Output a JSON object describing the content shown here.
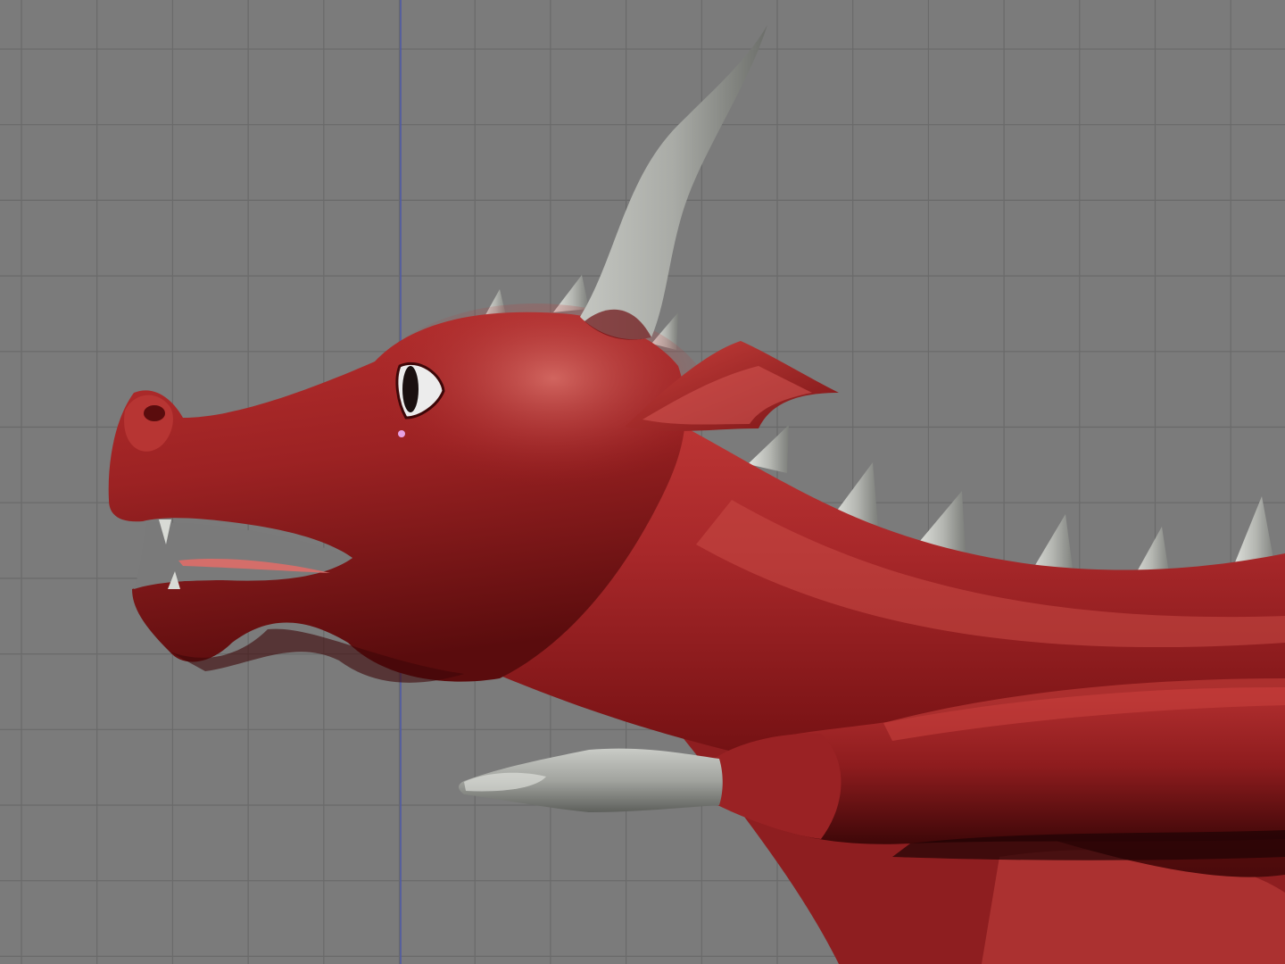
{
  "viewport": {
    "mode": "3d-modeling-viewport",
    "background_color": "#7b7b7b",
    "grid_line_color": "#6a6a6a",
    "axis_line_color": "#4f5aa6",
    "grid_visible": true
  },
  "model": {
    "subject": "red dragon",
    "body_color": "#a8282a",
    "body_shadow_color": "#4a0a0b",
    "body_highlight_color": "#d86a64",
    "horn_color": "#a9aba6",
    "horn_shadow_color": "#6c6e6a",
    "eye_white_color": "#ececec",
    "pupil_color": "#1a1010",
    "tongue_color": "#d46e6a",
    "tear_color": "#e6a2e4"
  }
}
